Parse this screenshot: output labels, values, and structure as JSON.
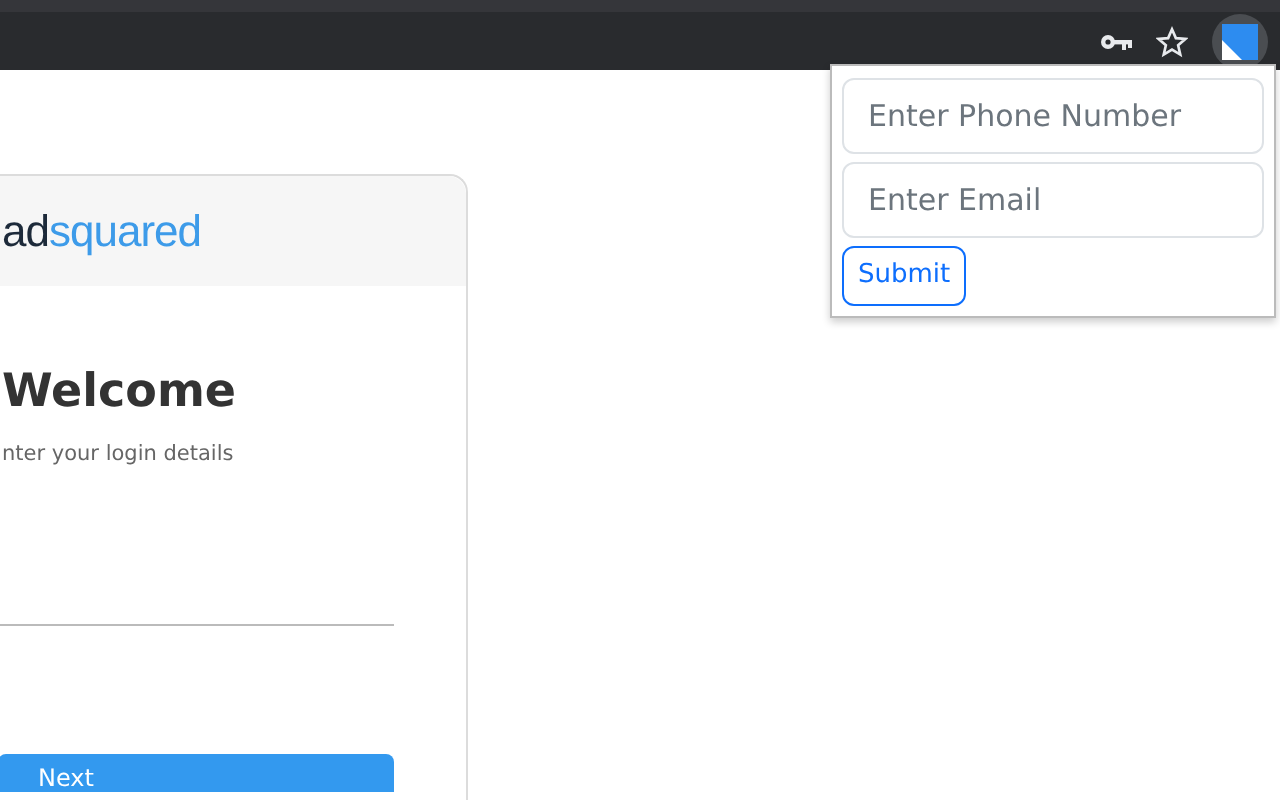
{
  "toolbar": {
    "icons": [
      {
        "kind": "key"
      },
      {
        "kind": "star"
      },
      {
        "kind": "extension"
      }
    ]
  },
  "popup": {
    "fields": [
      {
        "placeholder": "Enter Phone Number"
      },
      {
        "placeholder": "Enter Email"
      }
    ],
    "button": "Submit"
  },
  "login": {
    "logo": {
      "dark": "ad",
      "accent": "squared"
    },
    "title": "Welcome",
    "subtitle": "nter your login details",
    "button": "Next"
  }
}
